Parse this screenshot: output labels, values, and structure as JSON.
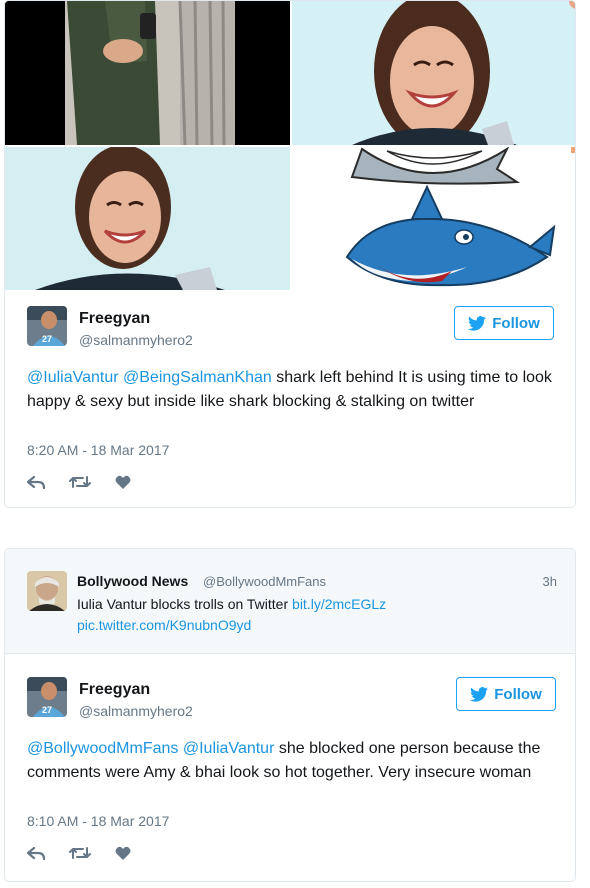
{
  "tweet1": {
    "name": "Freegyan",
    "handle": "@salmanmyhero2",
    "follow_label": "Follow",
    "mention1": "@IuliaVantur",
    "mention2": "@BeingSalmanKhan",
    "text": " shark left behind It is using time to look happy & sexy but inside like shark blocking & stalking on twitter",
    "timestamp": "8:20 AM - 18 Mar 2017",
    "avatar_badge": "27"
  },
  "quoted": {
    "name": "Bollywood News",
    "handle": "@BollywoodMmFans",
    "time": "3h",
    "text": "Iulia Vantur blocks trolls on Twitter ",
    "link1": "bit.ly/2mcEGLz",
    "link2": "pic.twitter.com/K9nubnO9yd"
  },
  "tweet2": {
    "name": "Freegyan",
    "handle": "@salmanmyhero2",
    "follow_label": "Follow",
    "mention1": "@BollywoodMmFans",
    "mention2": "@IuliaVantur",
    "text": " she blocked one person because the comments were Amy & bhai look so hot together. Very insecure woman",
    "timestamp": "8:10 AM - 18 Mar 2017",
    "avatar_badge": "27"
  },
  "icons": [
    "reply-icon",
    "retweet-icon",
    "like-icon",
    "twitter-bird-icon"
  ],
  "colors": {
    "link": "#1b95e0",
    "muted": "#657786",
    "border": "#e1e8ed",
    "quoted_bg": "#f5f8fa",
    "shark_blue": "#2a7bbf"
  }
}
